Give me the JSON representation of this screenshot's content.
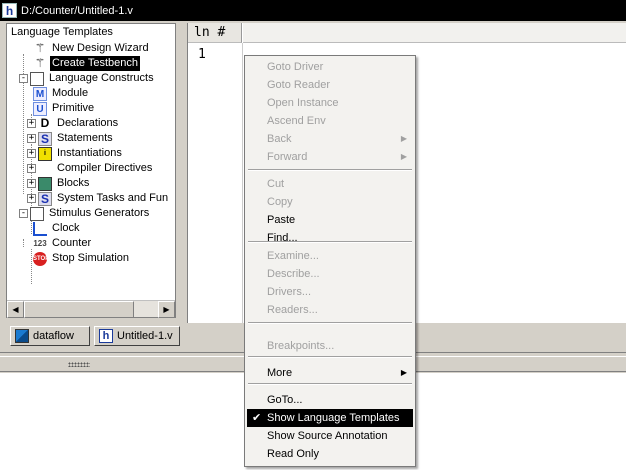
{
  "window": {
    "title": "D:/Counter/Untitled-1.v",
    "icon": "h"
  },
  "tree": {
    "root": "Language Templates",
    "items": [
      {
        "label": "New Design Wizard",
        "icon": "wand-icon"
      },
      {
        "label": "Create Testbench",
        "icon": "wand-icon",
        "selected": true
      },
      {
        "label": "Language Constructs",
        "icon": "document-icon",
        "expanded": true
      },
      {
        "label": "Module",
        "icon": "module-icon",
        "badge": "M"
      },
      {
        "label": "Primitive",
        "icon": "primitive-icon",
        "badge": "U"
      },
      {
        "label": "Declarations",
        "icon": "declaration-icon",
        "badge": "D"
      },
      {
        "label": "Statements",
        "icon": "statement-icon",
        "badge": "S"
      },
      {
        "label": "Instantiations",
        "icon": "instantiation-icon",
        "badge": "i"
      },
      {
        "label": "Compiler Directives",
        "icon": "directive-icon"
      },
      {
        "label": "Blocks",
        "icon": "blocks-icon"
      },
      {
        "label": "System Tasks and Fun",
        "icon": "system-task-icon",
        "badge": "S"
      },
      {
        "label": "Stimulus Generators",
        "icon": "stimulus-icon",
        "expanded": true
      },
      {
        "label": "Clock",
        "icon": "clock-icon"
      },
      {
        "label": "Counter",
        "icon": "counter-icon",
        "badge": "123"
      },
      {
        "label": "Stop Simulation",
        "icon": "stop-icon",
        "badge": "STOP"
      }
    ],
    "expander_plus": "+",
    "expander_minus": "-"
  },
  "editor": {
    "gutter_header": "ln #",
    "line_numbers": [
      "1"
    ]
  },
  "tabs": [
    {
      "label": "dataflow",
      "icon": "dataflow-icon"
    },
    {
      "label": "Untitled-1.v",
      "icon": "h"
    }
  ],
  "context_menu": {
    "groups": [
      [
        {
          "label": "Goto Driver",
          "enabled": false
        },
        {
          "label": "Goto Reader",
          "enabled": false
        },
        {
          "label": "Open Instance",
          "enabled": false
        },
        {
          "label": "Ascend Env",
          "enabled": false
        },
        {
          "label": "Back",
          "enabled": false,
          "submenu": true
        },
        {
          "label": "Forward",
          "enabled": false,
          "submenu": true
        }
      ],
      [
        {
          "label": "Cut",
          "enabled": false
        },
        {
          "label": "Copy",
          "enabled": false
        },
        {
          "label": "Paste",
          "enabled": true
        },
        {
          "label": "Find...",
          "enabled": true
        }
      ],
      [
        {
          "label": "Examine...",
          "enabled": false
        },
        {
          "label": "Describe...",
          "enabled": false
        },
        {
          "label": "Drivers...",
          "enabled": false
        },
        {
          "label": "Readers...",
          "enabled": false
        }
      ],
      [
        {
          "label": "Breakpoints...",
          "enabled": false
        }
      ],
      [
        {
          "label": "More",
          "enabled": true,
          "submenu": true
        }
      ],
      [
        {
          "label": "GoTo...",
          "enabled": true
        },
        {
          "label": "Show Language Templates",
          "enabled": true,
          "checked": true
        },
        {
          "label": "Show Source Annotation",
          "enabled": true
        },
        {
          "label": "Read Only",
          "enabled": true
        }
      ]
    ],
    "check_glyph": "✔",
    "arrow_glyph": "▶"
  },
  "colors": {
    "selection": "#000000",
    "disabled_text": "#a0a0a0",
    "face": "#d4d0c8"
  }
}
